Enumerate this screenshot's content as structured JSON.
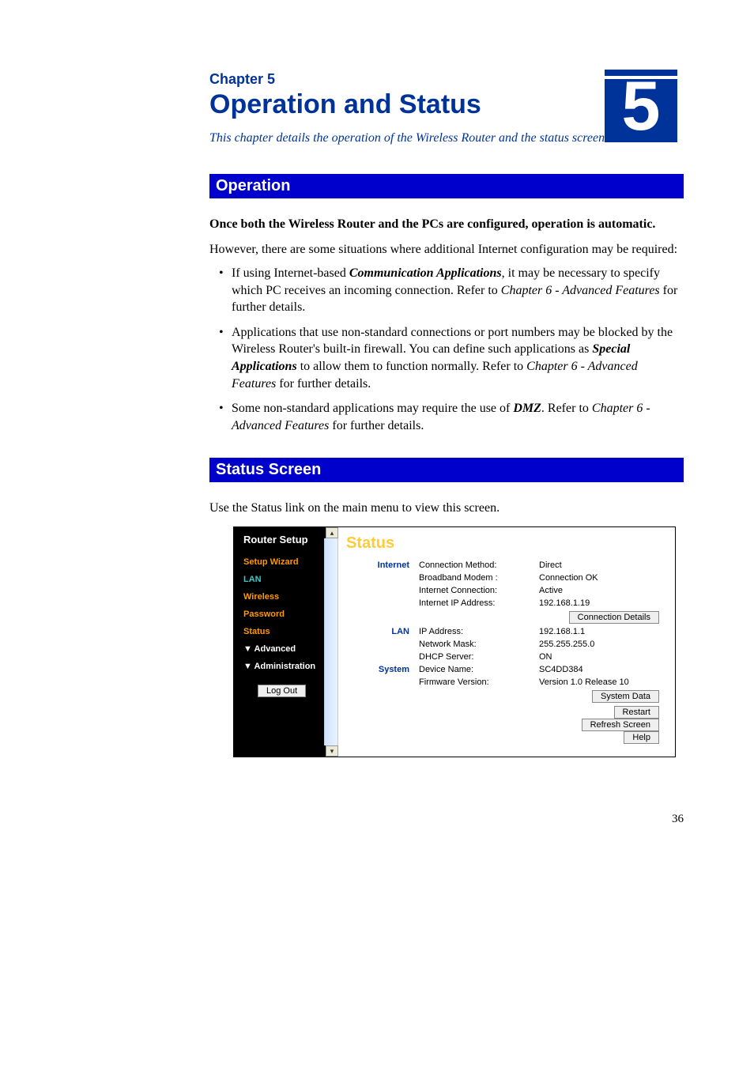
{
  "chapter": {
    "label": "Chapter 5",
    "title": "Operation and Status",
    "badge": "5",
    "intro": "This chapter details the operation of the Wireless Router and the status screens."
  },
  "section1": {
    "heading": "Operation",
    "bold_line": "Once both the Wireless Router and the PCs are configured, operation is automatic.",
    "intro_para": "However, there are some situations where additional Internet configuration may be required:",
    "bullet1": {
      "p1": "If using Internet-based ",
      "b1": "Communication Applications",
      "p2": ", it may be necessary to specify which PC receives an incoming connection. Refer to ",
      "i1": "Chapter 6 - Advanced Features",
      "p3": " for further details."
    },
    "bullet2": {
      "p1": "Applications that use non-standard connections or port numbers may be blocked by the Wireless Router's built-in firewall. You can define such applications as ",
      "b1": "Special Applications",
      "p2": " to allow them to function normally. Refer to ",
      "i1": "Chapter 6 - Advanced Features",
      "p3": " for further details."
    },
    "bullet3": {
      "p1": "Some non-standard applications may require the use of ",
      "b1": "DMZ",
      "p2": ". Refer to ",
      "i1": "Chapter 6 - Advanced Features",
      "p3": " for further details."
    }
  },
  "section2": {
    "heading": "Status Screen",
    "use_line_pre": "Use the ",
    "use_line_bold": "Status",
    "use_line_post": " link on the main menu to view this screen."
  },
  "ui": {
    "sidebar": {
      "title": "Router Setup",
      "items": {
        "setup_wizard": "Setup Wizard",
        "lan": "LAN",
        "wireless": "Wireless",
        "password": "Password",
        "status": "Status",
        "advanced": "▼ Advanced",
        "administration": "▼ Administration"
      },
      "logout": "Log Out"
    },
    "main": {
      "page_title": "Status",
      "groups": {
        "internet": "Internet",
        "lan": "LAN",
        "system": "System"
      },
      "internet": {
        "connection_method_label": "Connection Method:",
        "connection_method_value": "Direct",
        "broadband_modem_label": "Broadband Modem :",
        "broadband_modem_value": "Connection OK",
        "internet_connection_label": "Internet Connection:",
        "internet_connection_value": "Active",
        "internet_ip_label": "Internet IP Address:",
        "internet_ip_value": "192.168.1.19",
        "btn_connection_details": "Connection Details"
      },
      "lan_section": {
        "ip_label": "IP Address:",
        "ip_value": "192.168.1.1",
        "mask_label": "Network Mask:",
        "mask_value": "255.255.255.0",
        "dhcp_label": "DHCP Server:",
        "dhcp_value": "ON"
      },
      "system_section": {
        "device_name_label": "Device Name:",
        "device_name_value": "SC4DD384",
        "fw_label": "Firmware Version:",
        "fw_value": "Version 1.0 Release 10",
        "btn_system_data": "System Data"
      },
      "buttons": {
        "restart": "Restart",
        "refresh": "Refresh Screen",
        "help": "Help"
      }
    }
  },
  "page_number": "36"
}
